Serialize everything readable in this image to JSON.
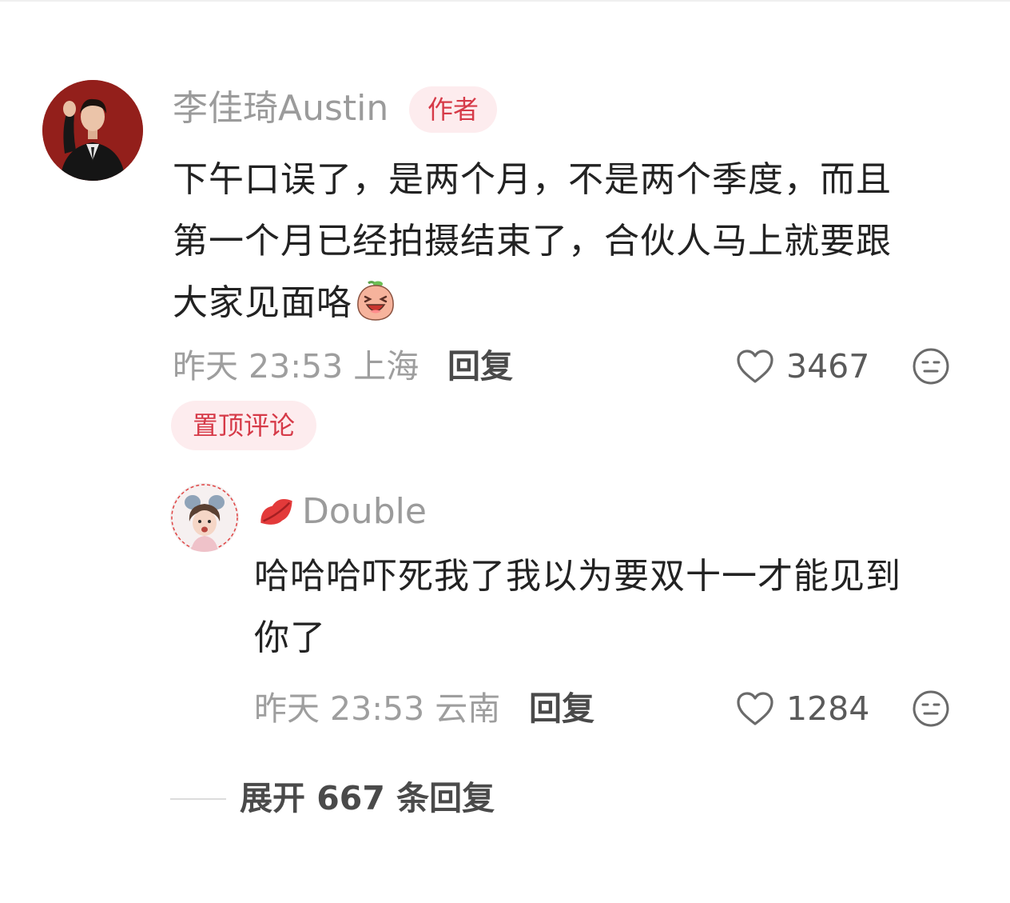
{
  "comment": {
    "author": "李佳琦Austin",
    "author_badge": "作者",
    "text_lines": [
      "下午口误了，是两个月，不是两个季度，而且",
      "第一个月已经拍摄结束了，合伙人马上就要跟",
      "大家见面咯"
    ],
    "emoji": "laughing-peach-emoji",
    "time_location": "昨天 23:53 上海",
    "reply_label": "回复",
    "likes": "3467",
    "pinned_label": "置顶评论",
    "colors": {
      "badge_bg": "#fdecee",
      "badge_text": "#d63a48"
    }
  },
  "reply": {
    "author_icon": "lips-icon",
    "author": "Double",
    "text_lines": [
      "哈哈哈吓死我了我以为要双十一才能见到",
      "你了"
    ],
    "time_location": "昨天 23:53 云南",
    "reply_label": "回复",
    "likes": "1284"
  },
  "expand": {
    "label": "展开 667 条回复"
  }
}
